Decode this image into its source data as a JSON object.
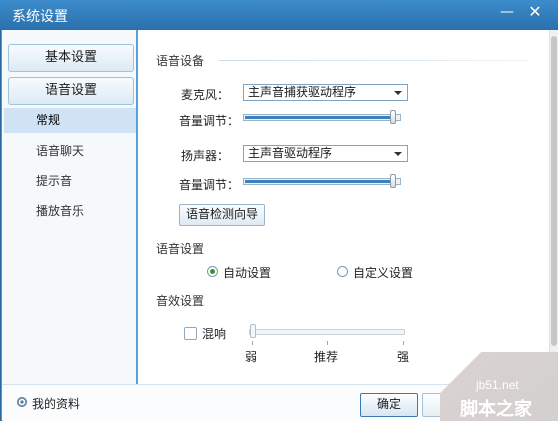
{
  "window": {
    "title": "系统设置",
    "minimize_glyph": "—",
    "close_glyph": "✕"
  },
  "sidebar": {
    "group_basic": "基本设置",
    "group_voice": "语音设置",
    "items": [
      {
        "label": "常规",
        "active": true
      },
      {
        "label": "语音聊天",
        "active": false
      },
      {
        "label": "提示音",
        "active": false
      },
      {
        "label": "播放音乐",
        "active": false
      }
    ]
  },
  "main": {
    "device_section": "语音设备",
    "mic_label": "麦克风：",
    "mic_value": "主声音捕获驱动程序",
    "volume_label": "音量调节：",
    "speaker_label": "扬声器：",
    "speaker_value": "主声音驱动程序",
    "mic_volume": 0.98,
    "speaker_volume": 0.98,
    "wizard_button": "语音检测向导",
    "voice_section": "语音设置",
    "auto_label": "自动设置",
    "custom_label": "自定义设置",
    "auto_selected": true,
    "effect_section": "音效设置",
    "reverb_label": "混响",
    "reverb_checked": false,
    "reverb_level": 0.0,
    "scale_weak": "弱",
    "scale_recommended": "推荐",
    "scale_strong": "强"
  },
  "footer": {
    "profile_label": "我的资料",
    "ok_button": "确定",
    "cancel_button": ""
  },
  "watermark": {
    "site": "jb51.net",
    "name": "脚本之家"
  },
  "colors": {
    "titlebar": "#2a70ad",
    "accent": "#5b9fd6",
    "radio_checked": "#2c9b2c"
  }
}
